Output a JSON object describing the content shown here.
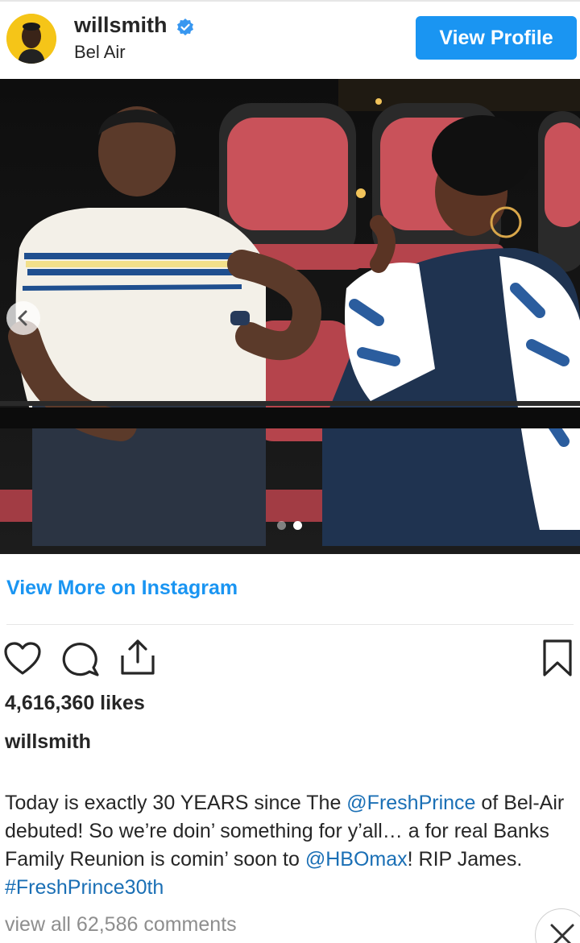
{
  "header": {
    "username": "willsmith",
    "location": "Bel Air",
    "view_profile_label": "View Profile"
  },
  "post": {
    "image_description_hidden": null,
    "carousel": {
      "total_slides": 2,
      "active_slide": 2
    },
    "view_more_label": "View More on Instagram",
    "likes_text": "4,616,360 likes",
    "owner": "willsmith",
    "caption": {
      "t1": "Today is exactly 30 YEARS since The ",
      "m1": "@FreshPrince",
      "t2": " of Bel-Air debuted! So we’re doin’ something for y’all… a for real Banks Family Reunion is comin’ soon to ",
      "m2": "@HBOmax",
      "t3": "! RIP James. ",
      "h1": "#FreshPrince30th"
    },
    "comments_label": "view all 62,586 comments"
  },
  "colors": {
    "accent": "#1a95f2",
    "link": "#1a6fb5",
    "muted": "#8e8e8e",
    "verified": "#3897f0"
  },
  "icons": [
    "heart-icon",
    "comment-icon",
    "share-icon",
    "bookmark-icon",
    "chevron-left-icon",
    "close-icon",
    "verified-badge-icon"
  ]
}
